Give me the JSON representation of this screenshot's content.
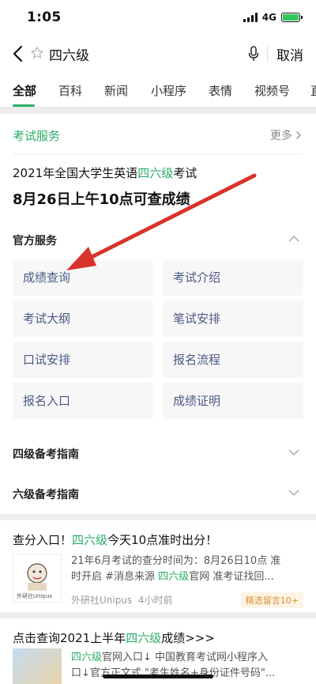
{
  "status": {
    "time": "1:05",
    "network": "4G"
  },
  "search": {
    "query": "四六级",
    "cancel": "取消"
  },
  "tabs": [
    "全部",
    "百科",
    "新闻",
    "小程序",
    "表情",
    "视频号",
    "直"
  ],
  "card": {
    "title": "考试服务",
    "more": "更多",
    "headline_prefix": "2021年全国大学生英语",
    "headline_highlight": "四六级",
    "headline_suffix": "考试",
    "headline_main": "8月26日上午10点可查成绩",
    "official_label": "官方服务",
    "services": [
      "成绩查询",
      "考试介绍",
      "考试大纲",
      "笔试安排",
      "口试安排",
      "报名流程",
      "报名入口",
      "成绩证明"
    ],
    "guide_cet4": "四级备考指南",
    "guide_cet6": "六级备考指南"
  },
  "result1": {
    "title_prefix": "查分入口！",
    "title_highlight": "四六级",
    "title_suffix": "今天10点准时出分！",
    "desc_line1": "21年6月考试的查分时间为：8月26日10点 准",
    "desc_line2_prefix": "时开启 #消息来源 ",
    "desc_line2_highlight": "四六级",
    "desc_line2_suffix": "官网 准考证找回...",
    "source": "外研社Unipus",
    "time": "4小时前",
    "tag": "精选留言10+",
    "thumb_text": "外研社Unipus"
  },
  "result2": {
    "title_prefix": "点击查询2021上半年",
    "title_highlight": "四六级",
    "title_suffix": "成绩>>>",
    "desc_prefix": "",
    "desc_highlight": "四六级",
    "desc_line1": "官网入口↓ 中国教育考试网小程序入",
    "desc_line2": "口↓官方正文式 \"考生姓名+身份证件号码\"..."
  },
  "colors": {
    "accent": "#2aae67",
    "link": "#4a5a86",
    "arrow": "#d8342c"
  }
}
